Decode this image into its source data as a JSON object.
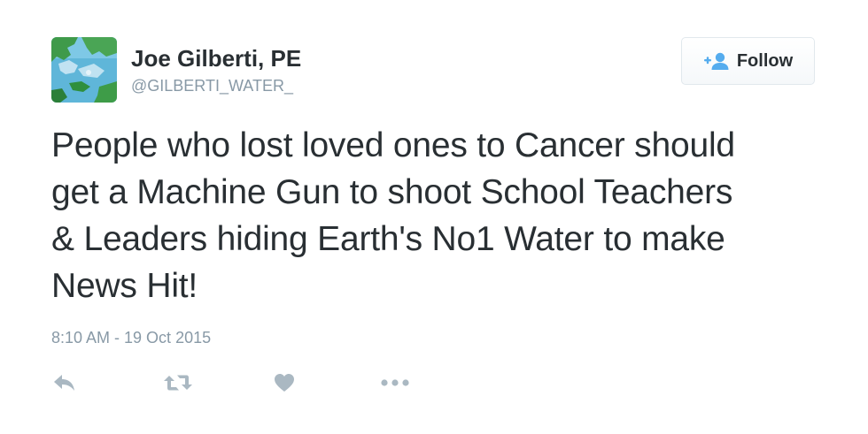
{
  "user": {
    "display_name": "Joe Gilberti, PE",
    "handle": "@GILBERTI_WATER_",
    "avatar_icon": "map-avatar"
  },
  "follow_button": {
    "label": "Follow",
    "icon": "add-user-icon"
  },
  "tweet": {
    "text_lines": [
      "People who lost loved ones to Cancer should",
      "get a Machine Gun to shoot School Teachers",
      "& Leaders hiding Earth's No1 Water to make",
      "News Hit!"
    ],
    "timestamp": "8:10 AM - 19 Oct 2015"
  },
  "actions": [
    {
      "name": "reply",
      "icon": "reply-icon"
    },
    {
      "name": "retweet",
      "icon": "retweet-icon"
    },
    {
      "name": "like",
      "icon": "heart-icon"
    },
    {
      "name": "more",
      "icon": "more-icon"
    }
  ],
  "colors": {
    "text": "#292f33",
    "secondary": "#8899a6",
    "action_icon": "#aab8c2",
    "follow_icon": "#55acee"
  }
}
